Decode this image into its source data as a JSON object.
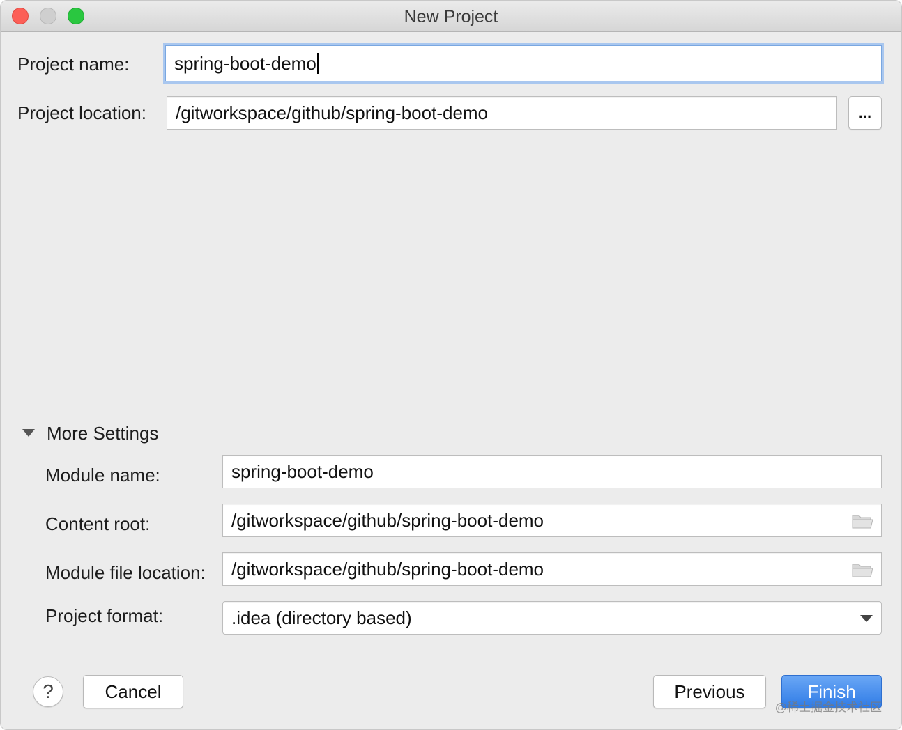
{
  "window": {
    "title": "New Project"
  },
  "project": {
    "name_label": "Project name:",
    "name_value": "spring-boot-demo",
    "location_label": "Project location:",
    "location_value": "/gitworkspace/github/spring-boot-demo",
    "browse_label": "..."
  },
  "more_settings": {
    "header": "More Settings",
    "module_name_label": "Module name:",
    "module_name_value": "spring-boot-demo",
    "content_root_label": "Content root:",
    "content_root_value": "/gitworkspace/github/spring-boot-demo",
    "module_file_label": "Module file location:",
    "module_file_value": "/gitworkspace/github/spring-boot-demo",
    "format_label": "Project format:",
    "format_value": ".idea (directory based)"
  },
  "footer": {
    "help_label": "?",
    "cancel_label": "Cancel",
    "previous_label": "Previous",
    "finish_label": "Finish",
    "watermark": "@稀土掘金技术社区"
  },
  "icons": {
    "close": "close-traffic-light-icon",
    "minimize": "minimize-traffic-light-icon",
    "maximize": "maximize-traffic-light-icon",
    "folder": "folder-icon",
    "disclosure": "disclosure-triangle-icon",
    "dropdown": "chevron-down-icon"
  },
  "colors": {
    "accent": "#2f7be6",
    "focus_ring": "#a9c7ef",
    "close": "#fc5f57",
    "maximize": "#2ac740"
  }
}
